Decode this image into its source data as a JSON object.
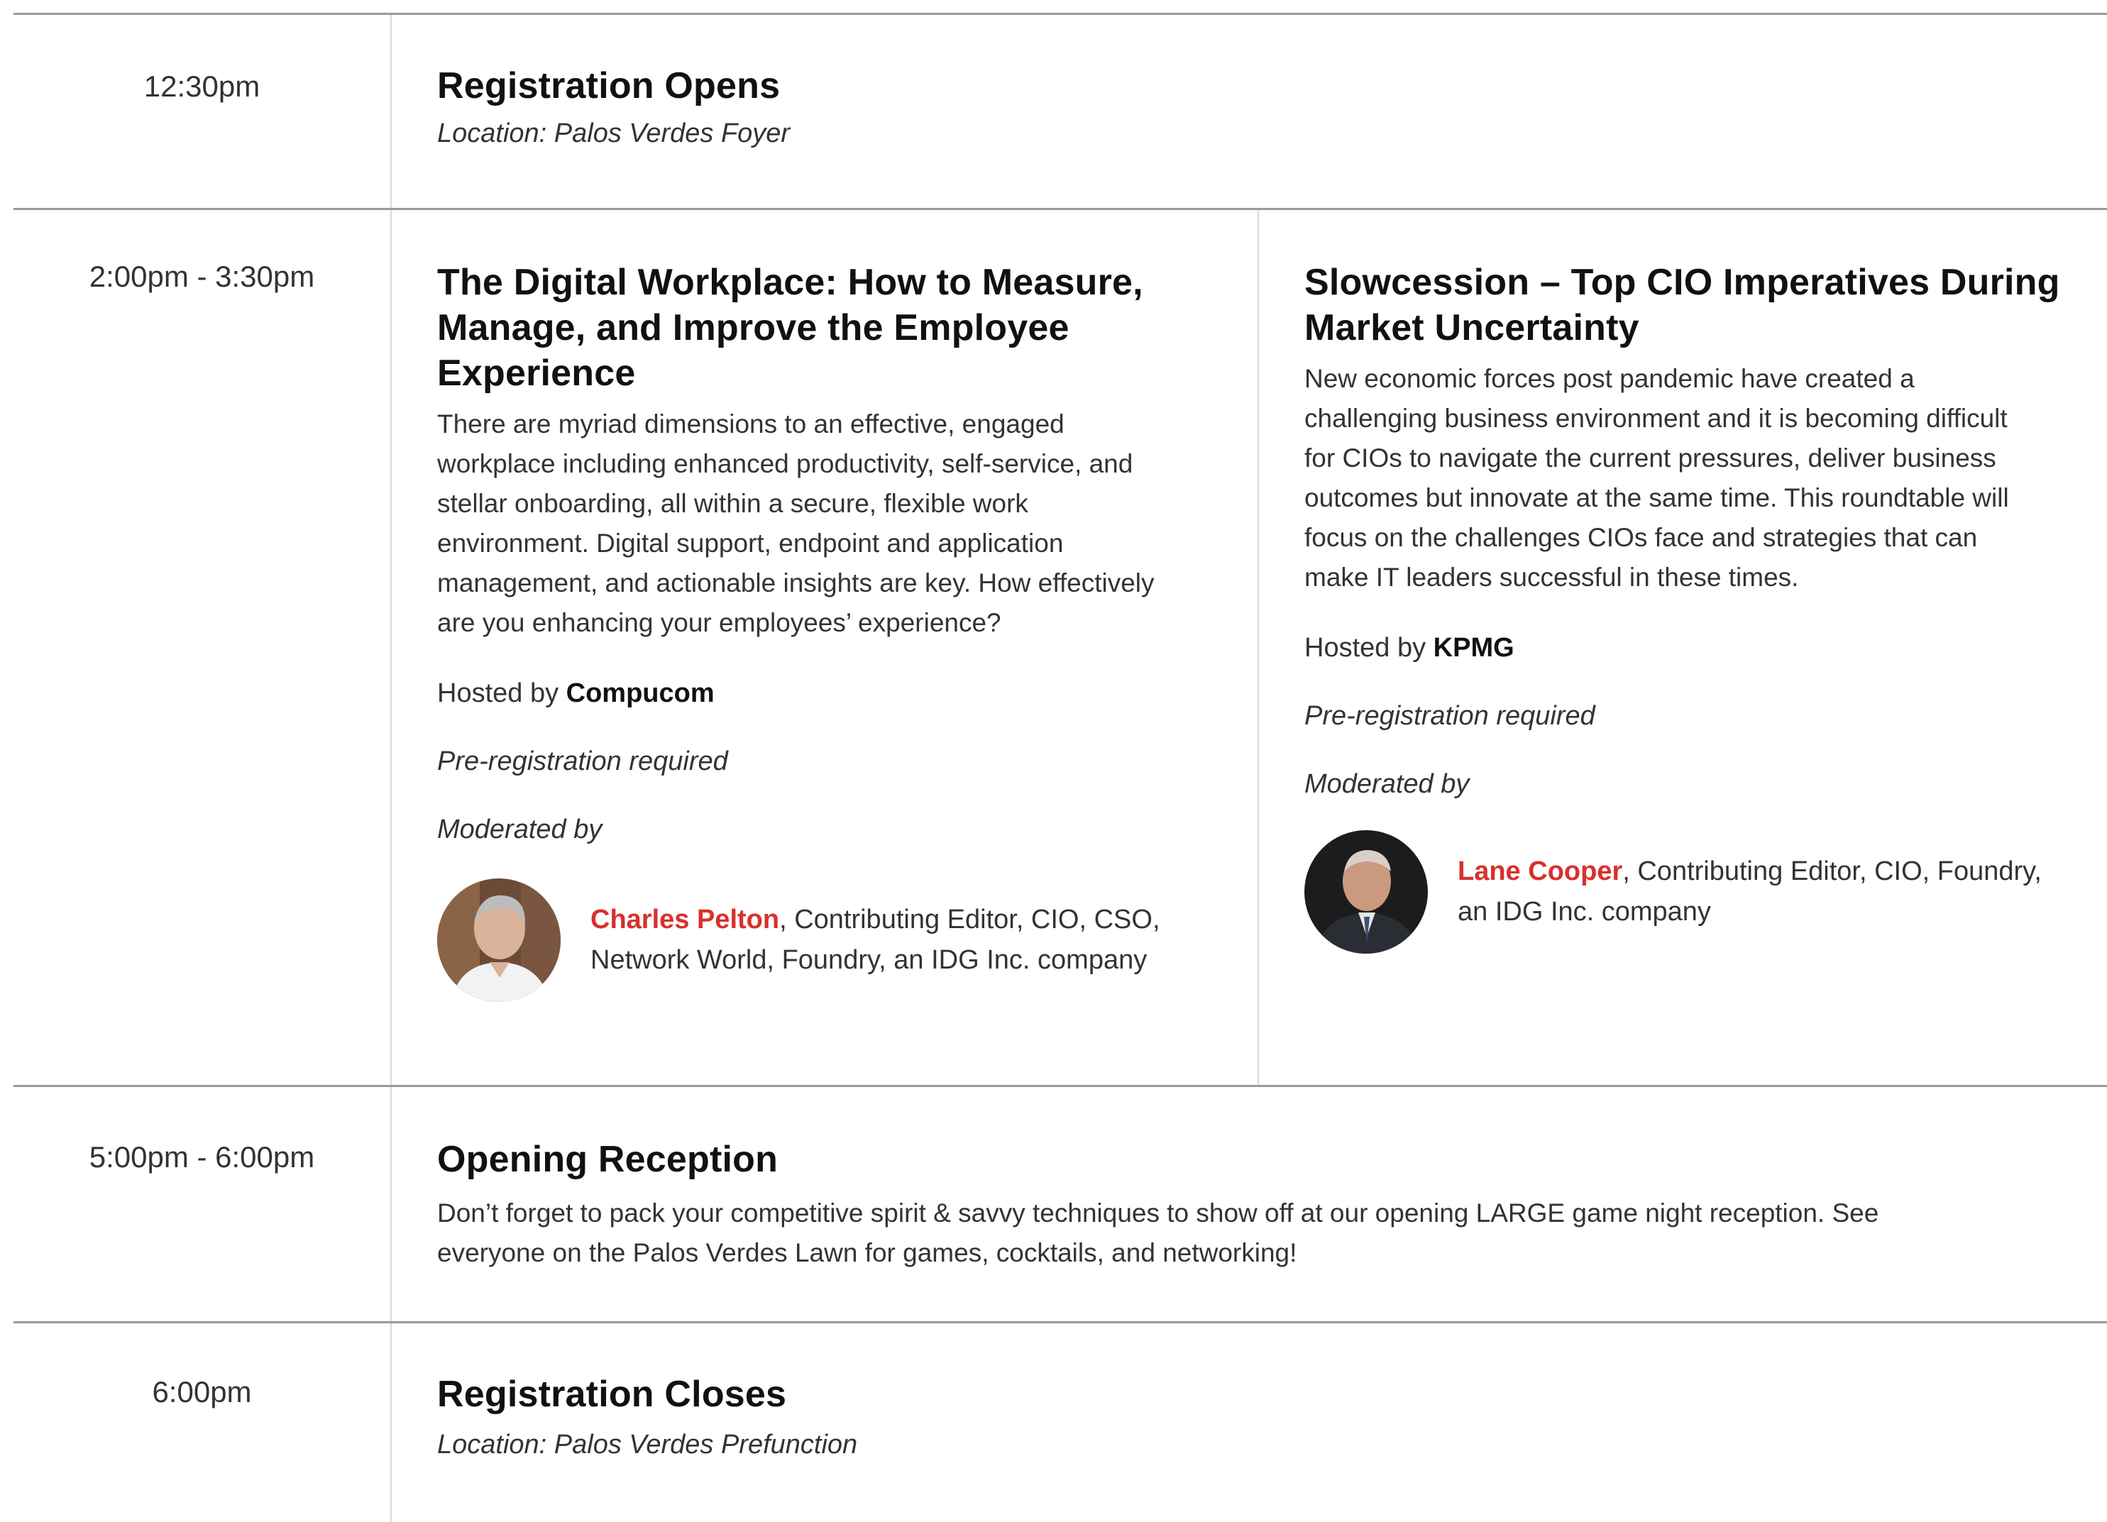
{
  "agenda": [
    {
      "time": "12:30pm",
      "sessions": [
        {
          "title": "Registration Opens",
          "location": "Location: Palos Verdes Foyer"
        }
      ]
    },
    {
      "time": "2:00pm - 3:30pm",
      "sessions": [
        {
          "title_lines": [
            "The Digital Workplace: How to Measure,",
            "Manage, and Improve the Employee",
            "Experience"
          ],
          "description_lines": [
            "There are myriad dimensions to an effective, engaged",
            "workplace including enhanced productivity, self-service, and",
            "stellar onboarding, all within a secure, flexible work",
            "environment. Digital support, endpoint and application",
            "management, and actionable insights are key. How effectively",
            "are you enhancing your employees’ experience?"
          ],
          "hosted_prefix": "Hosted by",
          "host": "Compucom",
          "preregistration": "Pre-registration required",
          "moderated_label": "Moderated by",
          "moderator": {
            "name": "Charles Pelton",
            "title_line1": ", Contributing Editor, CIO, CSO,",
            "title_line2": "Network World, Foundry, an IDG Inc. company"
          }
        },
        {
          "title_lines": [
            "Slowcession – Top CIO Imperatives During",
            "Market Uncertainty"
          ],
          "description_lines": [
            "New economic forces post pandemic have created a",
            "challenging business environment and it is becoming difficult",
            "for CIOs to navigate the current pressures, deliver business",
            "outcomes but innovate at the same time. This roundtable will",
            "focus on the challenges CIOs face and strategies that can",
            "make IT leaders successful in these times."
          ],
          "hosted_prefix": "Hosted by",
          "host": "KPMG",
          "preregistration": "Pre-registration required",
          "moderated_label": "Moderated by",
          "moderator": {
            "name": "Lane Cooper",
            "title_line1": ", Contributing Editor, CIO, Foundry,",
            "title_line2": "an IDG Inc. company"
          }
        }
      ]
    },
    {
      "time": "5:00pm - 6:00pm",
      "sessions": [
        {
          "title": "Opening Reception",
          "description_lines": [
            "Don’t forget to pack your competitive spirit & savvy techniques to show off at our opening LARGE game night reception. See",
            "everyone on the Palos Verdes Lawn for games, cocktails, and networking!"
          ]
        }
      ]
    },
    {
      "time": "6:00pm",
      "sessions": [
        {
          "title": "Registration Closes",
          "location": "Location: Palos Verdes Prefunction"
        }
      ]
    }
  ]
}
